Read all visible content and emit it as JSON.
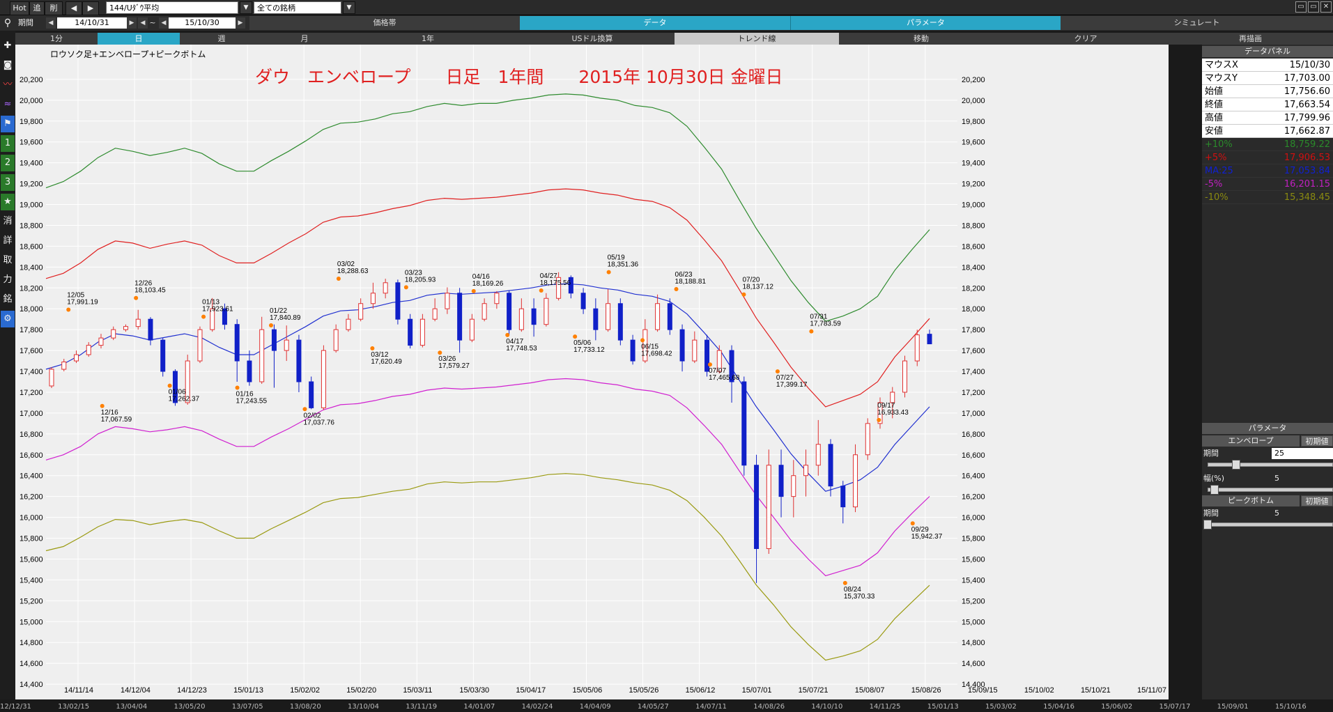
{
  "topbar": {
    "hot": "Hot",
    "tsui": "追",
    "saku": "削",
    "symbol": "144/Uﾀﾞｳ平均",
    "list": "全ての銘柄"
  },
  "row2": {
    "date_from": "14/10/31",
    "tilde": "~",
    "date_to": "15/10/30",
    "kikan": "期間",
    "tabs": [
      "価格帯",
      "データ",
      "パラメータ",
      "シミュレート"
    ]
  },
  "row3": [
    "1分",
    "日",
    "週",
    "月",
    "1年",
    "USドル換算",
    "トレンド線",
    "移動",
    "クリア",
    "再描画"
  ],
  "sidebar_icons": [
    "search-icon",
    "cross-icon",
    "camera-icon",
    "line-icon",
    "wave-icon",
    "flag-icon",
    "1",
    "2",
    "3",
    "★",
    "消",
    "詳",
    "取",
    "力",
    "銘",
    "gear-icon"
  ],
  "sidebar_text": {
    "one": "1",
    "two": "2",
    "three": "3",
    "star": "★",
    "kesu": "消",
    "shou": "詳",
    "tori": "取",
    "chikara": "力",
    "mei": "銘",
    "gear": "⚙"
  },
  "chart_header": "ロウソク足+エンベロープ+ピークボトム",
  "chart_title": "ダウ　エンベロープ　　日足　1年間　　2015年 10月30日 金曜日",
  "data_panel": {
    "title": "データパネル",
    "rows": [
      {
        "k": "マウスX",
        "v": "15/10/30",
        "color": "#000000"
      },
      {
        "k": "マウスY",
        "v": "17,703.00",
        "color": "#000000"
      },
      {
        "k": "始値",
        "v": "17,756.60",
        "color": "#000000"
      },
      {
        "k": "終値",
        "v": "17,663.54",
        "color": "#000000"
      },
      {
        "k": "高値",
        "v": "17,799.96",
        "color": "#000000"
      },
      {
        "k": "安値",
        "v": "17,662.87",
        "color": "#000000"
      },
      {
        "k": "+10%",
        "v": "18,759.22",
        "color": "#2a8a2a"
      },
      {
        "k": "+5%",
        "v": "17,906.53",
        "color": "#d01010"
      },
      {
        "k": "MA:25",
        "v": "17,053.84",
        "color": "#1020d0"
      },
      {
        "k": "-5%",
        "v": "16,201.15",
        "color": "#c020c0"
      },
      {
        "k": "-10%",
        "v": "15,348.45",
        "color": "#8a8a10"
      }
    ]
  },
  "param_panel": {
    "title": "パラメータ",
    "envelope": "エンベロープ",
    "reset": "初期値",
    "period_label": "期間",
    "period_value": "25",
    "width_label": "幅(%)",
    "width_value": "5",
    "peak": "ピークボトム",
    "peak_period_label": "期間",
    "peak_period_value": "5"
  },
  "bottom_dates": [
    "12/12/31",
    "13/02/15",
    "13/04/04",
    "13/05/20",
    "13/07/05",
    "13/08/20",
    "13/10/04",
    "13/11/19",
    "14/01/07",
    "14/02/24",
    "14/04/09",
    "14/05/27",
    "14/07/11",
    "14/08/26",
    "14/10/10",
    "14/11/25",
    "15/01/13",
    "15/03/02",
    "15/04/16",
    "15/06/02",
    "15/07/17",
    "15/09/01",
    "15/10/16"
  ],
  "colors": {
    "bg": "#efefef",
    "grid": "#ffffff",
    "up": "#e03030",
    "down": "#1020c8",
    "ma": "#2030d0",
    "p10": "#2e8b2e",
    "p5": "#e02020",
    "m5": "#d020d0",
    "m10": "#9a9a10",
    "label": "#cc0000",
    "marker": "#ff8000"
  },
  "chart_data": {
    "type": "line",
    "title": "ダウ　エンベロープ　　日足　1年間　　2015年 10月30日 金曜日",
    "ylim": [
      14200,
      20400
    ],
    "yticks": [
      14200,
      14400,
      14600,
      14800,
      15000,
      15200,
      15400,
      15600,
      15800,
      16000,
      16200,
      16400,
      16600,
      16800,
      17000,
      17200,
      17400,
      17600,
      17800,
      18000,
      18200,
      18400,
      18600,
      18800,
      19000,
      19200,
      19400,
      19600,
      19800,
      20000,
      20200
    ],
    "xticks": [
      "14/11/14",
      "14/12/04",
      "14/12/23",
      "15/01/13",
      "15/02/02",
      "15/02/20",
      "15/03/11",
      "15/03/30",
      "15/04/17",
      "15/05/06",
      "15/05/26",
      "15/06/12",
      "15/07/01",
      "15/07/21",
      "15/08/07",
      "15/08/26",
      "15/09/15",
      "15/10/02",
      "15/10/21",
      "15/11/07"
    ],
    "series": [
      {
        "name": "MA:25",
        "values": [
          17420,
          17470,
          17560,
          17680,
          17760,
          17740,
          17700,
          17730,
          17760,
          17720,
          17630,
          17560,
          17560,
          17650,
          17740,
          17830,
          17930,
          17980,
          17990,
          18020,
          18060,
          18080,
          18130,
          18150,
          18140,
          18150,
          18160,
          18180,
          18200,
          18230,
          18240,
          18230,
          18200,
          18180,
          18140,
          18120,
          18070,
          17950,
          17770,
          17580,
          17320,
          17060,
          16840,
          16610,
          16420,
          16250,
          16300,
          16360,
          16480,
          16700,
          16880,
          17060
        ]
      },
      {
        "name": "+5%",
        "values": [
          18290,
          18340,
          18440,
          18570,
          18650,
          18630,
          18580,
          18620,
          18650,
          18610,
          18510,
          18440,
          18440,
          18530,
          18630,
          18720,
          18830,
          18880,
          18890,
          18920,
          18960,
          18990,
          19040,
          19060,
          19050,
          19060,
          19070,
          19090,
          19110,
          19140,
          19150,
          19140,
          19110,
          19090,
          19050,
          19030,
          18970,
          18850,
          18660,
          18460,
          18190,
          17910,
          17680,
          17440,
          17240,
          17060,
          17120,
          17180,
          17300,
          17540,
          17720,
          17906.53
        ]
      },
      {
        "name": "+10%",
        "values": [
          19160,
          19220,
          19320,
          19450,
          19540,
          19510,
          19470,
          19500,
          19540,
          19490,
          19390,
          19320,
          19320,
          19420,
          19510,
          19610,
          19720,
          19780,
          19790,
          19820,
          19870,
          19890,
          19940,
          19970,
          19950,
          19970,
          19970,
          20000,
          20020,
          20050,
          20060,
          20050,
          20020,
          20000,
          19950,
          19930,
          19880,
          19750,
          19550,
          19340,
          19050,
          18770,
          18520,
          18270,
          18060,
          17880,
          17930,
          18000,
          18120,
          18370,
          18570,
          18759.22
        ]
      },
      {
        "name": "-5%",
        "values": [
          16550,
          16600,
          16680,
          16800,
          16870,
          16850,
          16820,
          16840,
          16870,
          16830,
          16750,
          16680,
          16680,
          16770,
          16850,
          16940,
          17030,
          17080,
          17090,
          17120,
          17160,
          17180,
          17220,
          17240,
          17230,
          17240,
          17250,
          17270,
          17290,
          17320,
          17330,
          17320,
          17290,
          17270,
          17230,
          17210,
          17170,
          17050,
          16880,
          16700,
          16450,
          16210,
          16000,
          15780,
          15600,
          15440,
          15490,
          15540,
          15660,
          15870,
          16040,
          16201.15
        ]
      },
      {
        "name": "-10%",
        "values": [
          15680,
          15720,
          15810,
          15910,
          15980,
          15970,
          15930,
          15960,
          15980,
          15950,
          15870,
          15800,
          15800,
          15890,
          15970,
          16050,
          16140,
          16180,
          16190,
          16220,
          16250,
          16270,
          16320,
          16340,
          16330,
          16340,
          16340,
          16360,
          16380,
          16410,
          16420,
          16410,
          16380,
          16360,
          16330,
          16310,
          16260,
          16160,
          16000,
          15820,
          15590,
          15350,
          15160,
          14950,
          14780,
          14630,
          14670,
          14720,
          14830,
          15030,
          15190,
          15348.45
        ]
      }
    ],
    "candles": [
      [
        17260,
        17420,
        17240,
        17440
      ],
      [
        17420,
        17490,
        17400,
        17520
      ],
      [
        17500,
        17560,
        17480,
        17600
      ],
      [
        17560,
        17650,
        17540,
        17680
      ],
      [
        17650,
        17720,
        17620,
        17760
      ],
      [
        17720,
        17800,
        17700,
        17830
      ],
      [
        17800,
        17830,
        17780,
        17850
      ],
      [
        17830,
        17900,
        17800,
        17990
      ],
      [
        17900,
        17700,
        17650,
        17920
      ],
      [
        17700,
        17400,
        17350,
        17720
      ],
      [
        17400,
        17100,
        17070,
        17420
      ],
      [
        17100,
        17500,
        17080,
        17560
      ],
      [
        17500,
        17800,
        17480,
        17830
      ],
      [
        17800,
        18000,
        17780,
        18103
      ],
      [
        18000,
        17850,
        17800,
        18050
      ],
      [
        17850,
        17500,
        17300,
        17900
      ],
      [
        17500,
        17300,
        17262,
        17600
      ],
      [
        17300,
        17800,
        17280,
        17923
      ],
      [
        17800,
        17600,
        17243,
        17850
      ],
      [
        17600,
        17700,
        17500,
        17840
      ],
      [
        17700,
        17300,
        17200,
        17750
      ],
      [
        17300,
        17050,
        17037,
        17350
      ],
      [
        17050,
        17600,
        17030,
        17650
      ],
      [
        17600,
        17800,
        17580,
        17850
      ],
      [
        17800,
        17900,
        17780,
        17950
      ],
      [
        17900,
        18050,
        17880,
        18100
      ],
      [
        18050,
        18150,
        18000,
        18250
      ],
      [
        18150,
        18250,
        18100,
        18288
      ],
      [
        18250,
        17900,
        17850,
        18280
      ],
      [
        17900,
        17650,
        17620,
        17950
      ],
      [
        17650,
        17900,
        17630,
        17950
      ],
      [
        17900,
        18000,
        17880,
        18100
      ],
      [
        18000,
        18150,
        17950,
        18205
      ],
      [
        18150,
        17700,
        17579,
        18200
      ],
      [
        17700,
        17900,
        17680,
        17950
      ],
      [
        17900,
        18050,
        17880,
        18100
      ],
      [
        18050,
        18150,
        18000,
        18169
      ],
      [
        18150,
        17800,
        17748,
        18175
      ],
      [
        17800,
        18000,
        17780,
        18100
      ],
      [
        18000,
        17850,
        17733,
        18100
      ],
      [
        17850,
        18100,
        17830,
        18150
      ],
      [
        18100,
        18300,
        18080,
        18351
      ],
      [
        18300,
        18150,
        18100,
        18320
      ],
      [
        18150,
        18000,
        17950,
        18200
      ],
      [
        18000,
        17800,
        17698,
        18100
      ],
      [
        17800,
        18050,
        17780,
        18188
      ],
      [
        18050,
        17700,
        17650,
        18100
      ],
      [
        17700,
        17500,
        17465,
        17750
      ],
      [
        17500,
        17800,
        17480,
        17900
      ],
      [
        17800,
        18050,
        17780,
        18137
      ],
      [
        18050,
        17800,
        17750,
        18100
      ],
      [
        17800,
        17500,
        17399,
        17850
      ],
      [
        17500,
        17700,
        17480,
        17783
      ],
      [
        17700,
        17400,
        17350,
        17750
      ],
      [
        17400,
        17600,
        17380,
        17650
      ],
      [
        17600,
        17300,
        17100,
        17650
      ],
      [
        17300,
        16500,
        16400,
        17350
      ],
      [
        16500,
        15700,
        15370,
        16600
      ],
      [
        15700,
        16500,
        15650,
        16650
      ],
      [
        16500,
        16200,
        16000,
        16650
      ],
      [
        16200,
        16400,
        16000,
        16550
      ],
      [
        16400,
        16500,
        16200,
        16650
      ],
      [
        16500,
        16700,
        16400,
        16933
      ],
      [
        16700,
        16300,
        16200,
        16750
      ],
      [
        16300,
        16100,
        15942,
        16350
      ],
      [
        16100,
        16600,
        16050,
        16700
      ],
      [
        16600,
        16900,
        16550,
        16950
      ],
      [
        16900,
        17100,
        16850,
        17150
      ],
      [
        17100,
        17200,
        16950,
        17250
      ],
      [
        17200,
        17500,
        17150,
        17550
      ],
      [
        17500,
        17750,
        17450,
        17800
      ],
      [
        17756.6,
        17663.54,
        17662.87,
        17799.96
      ]
    ],
    "peaks": [
      {
        "date": "12/05",
        "value": "17,991.19",
        "kind": "peak"
      },
      {
        "date": "12/16",
        "value": "17,067.59",
        "kind": "bottom"
      },
      {
        "date": "12/26",
        "value": "18,103.45",
        "kind": "peak"
      },
      {
        "date": "01/06",
        "value": "17,262.37",
        "kind": "bottom"
      },
      {
        "date": "01/13",
        "value": "17,923.61",
        "kind": "peak"
      },
      {
        "date": "01/16",
        "value": "17,243.55",
        "kind": "bottom"
      },
      {
        "date": "01/22",
        "value": "17,840.89",
        "kind": "peak"
      },
      {
        "date": "02/02",
        "value": "17,037.76",
        "kind": "bottom"
      },
      {
        "date": "03/02",
        "value": "18,288.63",
        "kind": "peak"
      },
      {
        "date": "03/12",
        "value": "17,620.49",
        "kind": "bottom"
      },
      {
        "date": "03/23",
        "value": "18,205.93",
        "kind": "peak"
      },
      {
        "date": "03/26",
        "value": "17,579.27",
        "kind": "bottom"
      },
      {
        "date": "04/16",
        "value": "18,169.26",
        "kind": "peak"
      },
      {
        "date": "04/17",
        "value": "17,748.53",
        "kind": "bottom"
      },
      {
        "date": "04/27",
        "value": "18,175.56",
        "kind": "peak"
      },
      {
        "date": "05/06",
        "value": "17,733.12",
        "kind": "bottom"
      },
      {
        "date": "05/19",
        "value": "18,351.36",
        "kind": "peak"
      },
      {
        "date": "06/15",
        "value": "17,698.42",
        "kind": "bottom"
      },
      {
        "date": "06/23",
        "value": "18,188.81",
        "kind": "peak"
      },
      {
        "date": "07/07",
        "value": "17,465.68",
        "kind": "bottom"
      },
      {
        "date": "07/20",
        "value": "18,137.12",
        "kind": "peak"
      },
      {
        "date": "07/27",
        "value": "17,399.17",
        "kind": "bottom"
      },
      {
        "date": "07/31",
        "value": "17,783.59",
        "kind": "peak"
      },
      {
        "date": "08/24",
        "value": "15,370.33",
        "kind": "bottom"
      },
      {
        "date": "09/17",
        "value": "16,933.43",
        "kind": "peak"
      },
      {
        "date": "09/29",
        "value": "15,942.37",
        "kind": "bottom"
      }
    ]
  }
}
